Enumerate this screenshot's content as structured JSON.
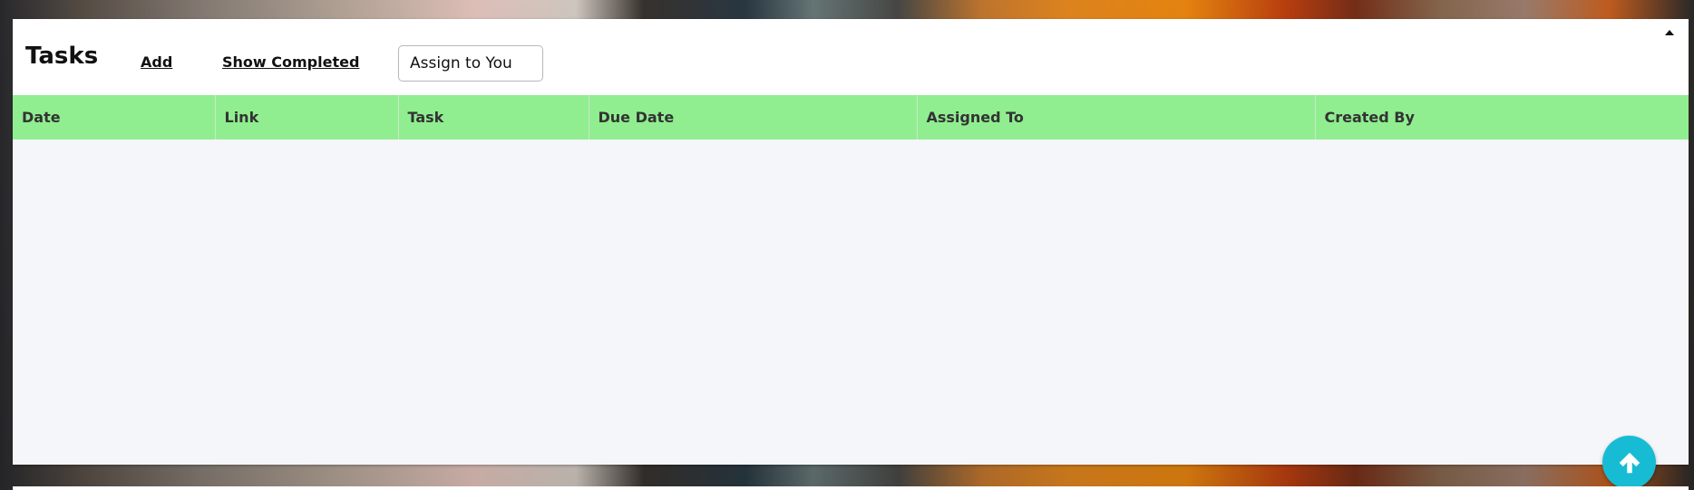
{
  "panel": {
    "title": "Tasks",
    "add_label": "Add",
    "show_completed_label": "Show Completed",
    "assign_label": "Assign to You",
    "collapse_icon": "caret-up-icon"
  },
  "table": {
    "columns": [
      "Date",
      "Link",
      "Task",
      "Due Date",
      "Assigned To",
      "Created By"
    ],
    "rows": []
  },
  "scroll_top": {
    "icon": "arrow-up-icon",
    "color": "#17bcd4"
  },
  "colors": {
    "header_row": "#90ee90",
    "body_bg": "#f4f6f9"
  }
}
